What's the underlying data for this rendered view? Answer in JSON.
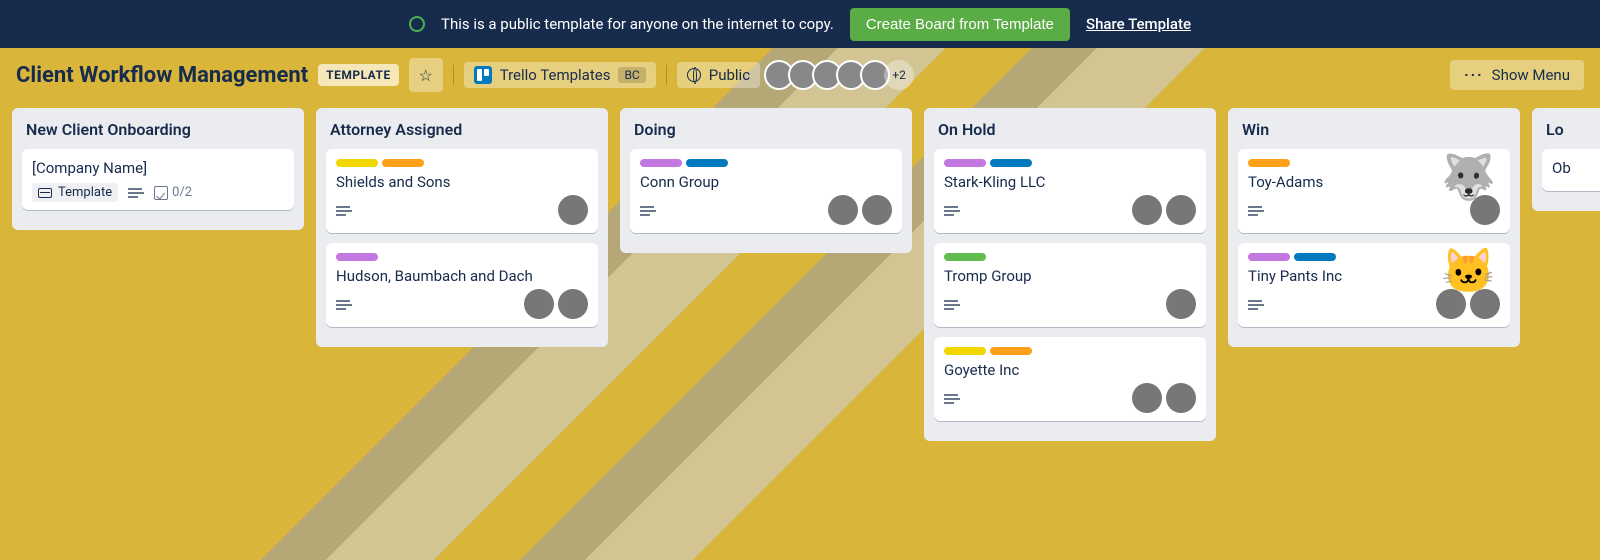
{
  "banner": {
    "message": "This is a public template for anyone on the internet to copy.",
    "create_btn": "Create Board from Template",
    "share": "Share Template"
  },
  "header": {
    "title": "Client Workflow Management",
    "template_chip": "TEMPLATE",
    "workspace": "Trello Templates",
    "workspace_abbr": "BC",
    "visibility": "Public",
    "member_overflow": "+2",
    "show_menu": "Show Menu"
  },
  "lists": [
    {
      "title": "New Client Onboarding",
      "cards": [
        {
          "title": "[Company Name]",
          "template_badge": "Template",
          "checklist": "0/2",
          "has_desc": true
        }
      ]
    },
    {
      "title": "Attorney Assigned",
      "cards": [
        {
          "title": "Shields and Sons",
          "labels": [
            "yellow",
            "orange"
          ],
          "has_desc": true,
          "members": [
            "c1"
          ]
        },
        {
          "title": "Hudson, Baumbach and Dach",
          "labels": [
            "purple"
          ],
          "has_desc": true,
          "members": [
            "c2",
            "c3"
          ]
        }
      ]
    },
    {
      "title": "Doing",
      "cards": [
        {
          "title": "Conn Group",
          "labels": [
            "purple",
            "blue"
          ],
          "has_desc": true,
          "members": [
            "c4",
            "c5"
          ]
        }
      ]
    },
    {
      "title": "On Hold",
      "cards": [
        {
          "title": "Stark-Kling LLC",
          "labels": [
            "purple",
            "blue"
          ],
          "has_desc": true,
          "members": [
            "c2",
            "c5"
          ]
        },
        {
          "title": "Tromp Group",
          "labels": [
            "green"
          ],
          "has_desc": true,
          "members": [
            "c3"
          ]
        },
        {
          "title": "Goyette Inc",
          "labels": [
            "yellow",
            "orange"
          ],
          "has_desc": true,
          "members": [
            "c2",
            "c5"
          ]
        }
      ]
    },
    {
      "title": "Win",
      "cards": [
        {
          "title": "Toy-Adams",
          "labels": [
            "orange"
          ],
          "has_desc": true,
          "members": [
            "c1"
          ],
          "sticker": "🐺"
        },
        {
          "title": "Tiny Pants Inc",
          "labels": [
            "purple",
            "blue"
          ],
          "has_desc": true,
          "members": [
            "c3",
            "c5"
          ],
          "sticker": "🐱"
        }
      ]
    },
    {
      "title": "Lo",
      "cards": [
        {
          "title": "Ob"
        }
      ]
    }
  ]
}
